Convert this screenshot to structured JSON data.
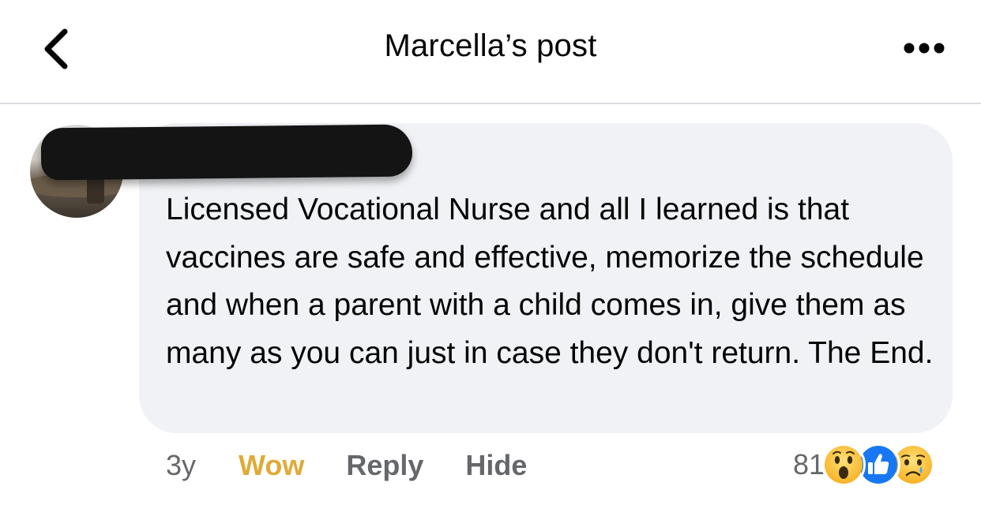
{
  "header": {
    "title": "Marcella’s post",
    "back_icon": "chevron-left-icon",
    "more_icon": "ellipsis-icon"
  },
  "comment": {
    "author_redacted": true,
    "text": "Licensed Vocational Nurse and all I learned is that vaccines are safe and effective, memorize the schedule and when a parent with a child comes in, give them as many as you can just in case they don't return. The End.",
    "timestamp": "3y",
    "actions": {
      "wow_label": "Wow",
      "reply_label": "Reply",
      "hide_label": "Hide"
    },
    "reactions": {
      "count": "81",
      "icons": [
        "wow-reaction-icon",
        "like-reaction-icon",
        "sad-reaction-icon"
      ]
    }
  },
  "colors": {
    "bubble_bg": "#f0f2f5",
    "wow_accent": "#e0aa38",
    "secondary_text": "#65676b",
    "like_blue": "#1877f2"
  }
}
